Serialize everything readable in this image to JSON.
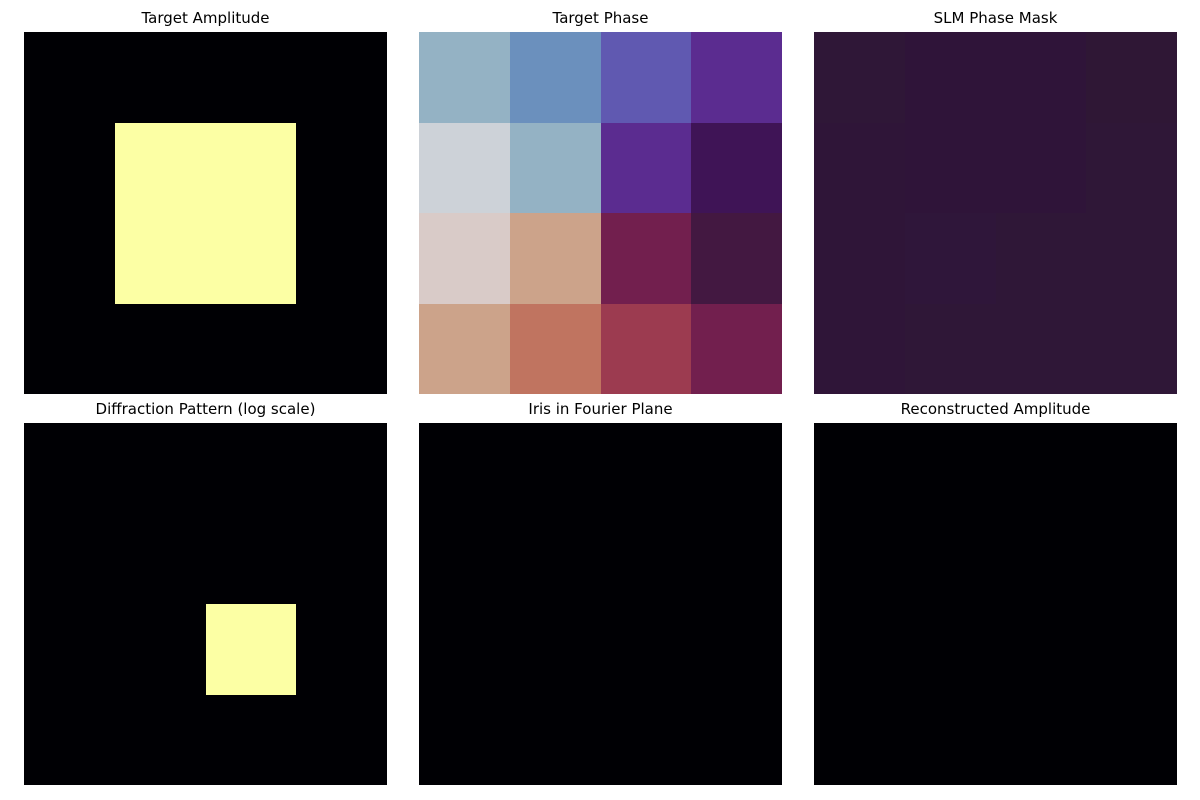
{
  "chart_data": [
    {
      "type": "heatmap",
      "title": "Target Amplitude",
      "colormap": "inferno",
      "vmin": 0,
      "vmax": 1,
      "axes": "off",
      "grid": [
        [
          0,
          0,
          0,
          0
        ],
        [
          0,
          1,
          1,
          0
        ],
        [
          0,
          1,
          1,
          0
        ],
        [
          0,
          0,
          0,
          0
        ]
      ]
    },
    {
      "type": "heatmap",
      "title": "Target Phase",
      "colormap": "twilight",
      "axes": "off",
      "grid": [
        [
          "#94b2c4",
          "#6b90bd",
          "#6059b1",
          "#5b2c90"
        ],
        [
          "#cdd2d8",
          "#94b2c4",
          "#5b2c90",
          "#3f1456"
        ],
        [
          "#d9cbc8",
          "#cca38a",
          "#721f4e",
          "#431841"
        ],
        [
          "#cca38a",
          "#c07460",
          "#9c3b50",
          "#721f4e"
        ]
      ]
    },
    {
      "type": "heatmap",
      "title": "SLM Phase Mask",
      "colormap": "twilight",
      "axes": "off",
      "grid": [
        [
          "#2f1737",
          "#2f1439",
          "#2f1439",
          "#2f1735"
        ],
        [
          "#2f1538",
          "#2f1439",
          "#2f1439",
          "#2f1737"
        ],
        [
          "#2f1538",
          "#2f163a",
          "#2f1737",
          "#2f1737"
        ],
        [
          "#2f1538",
          "#2f1737",
          "#2f1737",
          "#2f1737"
        ]
      ]
    },
    {
      "type": "heatmap",
      "title": "Diffraction Pattern (log scale)",
      "colormap": "inferno",
      "vmin": 0,
      "vmax": 1,
      "axes": "off",
      "grid": [
        [
          0,
          0,
          0,
          0
        ],
        [
          0,
          0,
          0,
          0
        ],
        [
          0,
          0,
          1,
          0
        ],
        [
          0,
          0,
          0,
          0
        ]
      ]
    },
    {
      "type": "heatmap",
      "title": "Iris in Fourier Plane",
      "colormap": "inferno",
      "vmin": 0,
      "vmax": 1,
      "axes": "off",
      "grid": [
        [
          0,
          0,
          0,
          0
        ],
        [
          0,
          0,
          0,
          0
        ],
        [
          0,
          0,
          0,
          0
        ],
        [
          0,
          0,
          0,
          0
        ]
      ]
    },
    {
      "type": "heatmap",
      "title": "Reconstructed Amplitude",
      "colormap": "inferno",
      "vmin": 0,
      "vmax": 1,
      "axes": "off",
      "grid": [
        [
          0,
          0,
          0,
          0
        ],
        [
          0,
          0,
          0,
          0
        ],
        [
          0,
          0,
          0,
          0
        ],
        [
          0,
          0,
          0,
          0
        ]
      ]
    }
  ],
  "colors": {
    "inferno_low": "#000004",
    "inferno_high": "#fcffa4"
  }
}
